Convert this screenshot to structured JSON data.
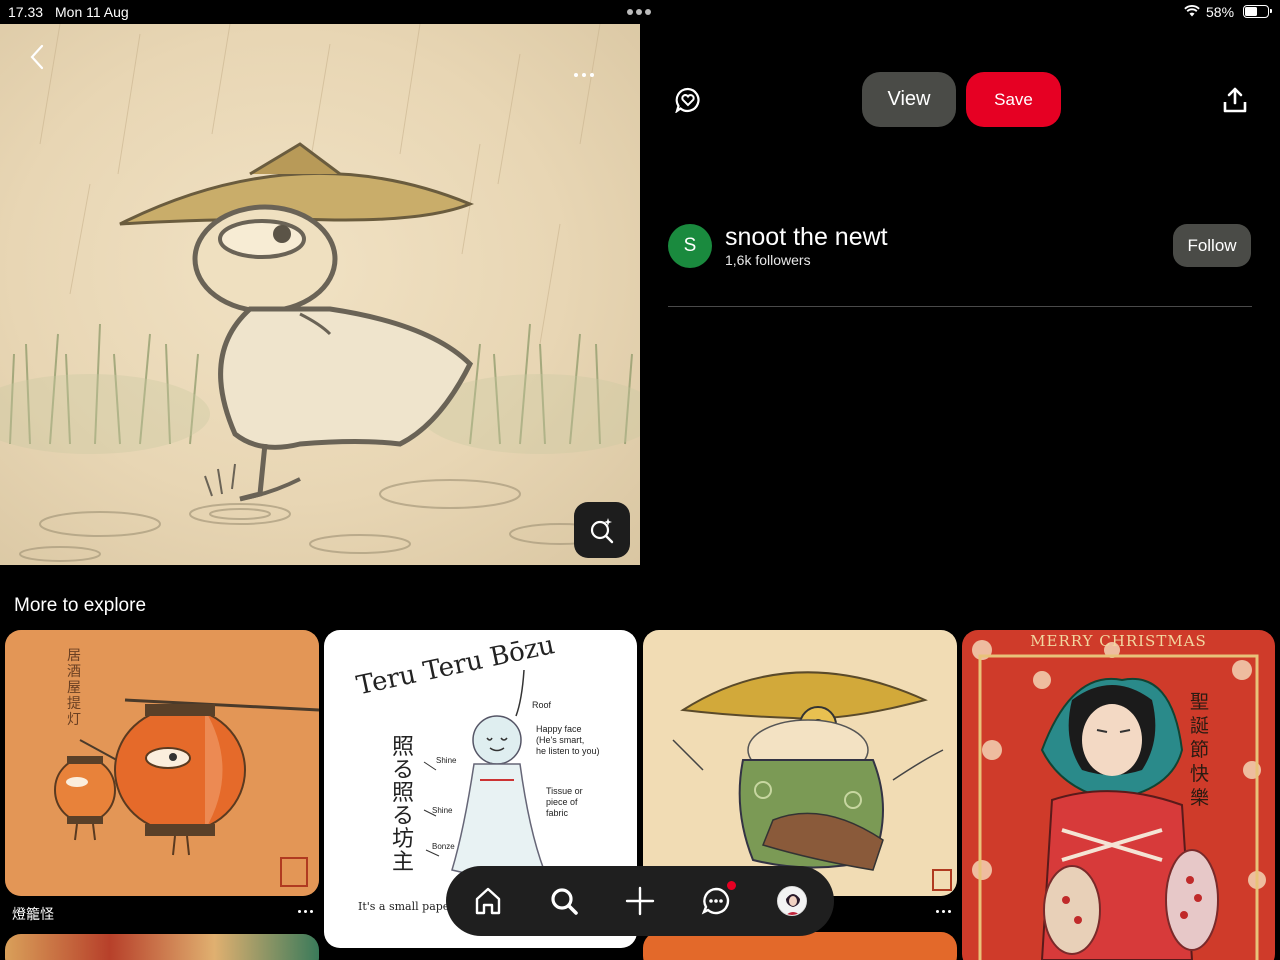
{
  "status_bar": {
    "time": "17.33",
    "date": "Mon 11 Aug",
    "battery": "58%",
    "battery_level": 0.58
  },
  "pin": {
    "image_description_icon": "lens-search-icon"
  },
  "actions": {
    "view_label": "View",
    "save_label": "Save"
  },
  "creator": {
    "initial": "S",
    "name": "snoot the newt",
    "followers": "1,6k followers",
    "follow_label": "Follow"
  },
  "explore": {
    "title": "More to explore",
    "cards": [
      {
        "caption": "燈籠怪"
      },
      {
        "caption": ""
      },
      {
        "caption": ""
      },
      {
        "caption": ""
      }
    ],
    "card2_text": {
      "title": "Teru Teru Bōzu",
      "roof": "Roof",
      "happy_face": "Happy face",
      "happy_face_2": "(He's smart,",
      "happy_face_3": "he listen to you)",
      "tissue": "Tissue or",
      "tissue_2": "piece of",
      "tissue_3": "fabric",
      "shine1": "Shine",
      "shine2": "Shine",
      "bonze": "Bonze",
      "kanji": "照る照る坊主",
      "footer": "It's a small paper doll"
    },
    "card4_title": "MERRY CHRISTMAS",
    "card4_kanji": "聖誕節快樂"
  },
  "colors": {
    "save": "#e60023",
    "view": "#4a4b47",
    "avatar": "#1a8a3e"
  }
}
